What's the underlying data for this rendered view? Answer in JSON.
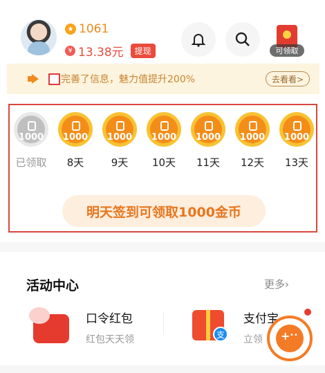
{
  "header": {
    "coins": "1061",
    "coin_icon": "star-coin-icon",
    "balance": "13.38元",
    "yuan_symbol": "¥",
    "withdraw_label": "提现",
    "redpack_tag": "可领取"
  },
  "tip": {
    "text": "完善了信息，魅力值提升200%",
    "button": "去看看>"
  },
  "signin": {
    "days": [
      {
        "label": "已领取",
        "amount": "1000",
        "claimed": true
      },
      {
        "label": "8天",
        "amount": "1000",
        "claimed": false
      },
      {
        "label": "9天",
        "amount": "1000",
        "claimed": false
      },
      {
        "label": "10天",
        "amount": "1000",
        "claimed": false
      },
      {
        "label": "11天",
        "amount": "1000",
        "claimed": false
      },
      {
        "label": "12天",
        "amount": "1000",
        "claimed": false
      },
      {
        "label": "13天",
        "amount": "1000",
        "claimed": false
      }
    ],
    "cta": "明天签到可领取1000金币"
  },
  "activity": {
    "title": "活动中心",
    "more": "更多",
    "items": [
      {
        "name": "口令红包",
        "sub": "红包天天领"
      },
      {
        "name": "支付宝",
        "sub": "立领"
      }
    ],
    "alipay_badge": "支"
  },
  "colors": {
    "accent": "#f08a1e",
    "red": "#e84c3d"
  }
}
